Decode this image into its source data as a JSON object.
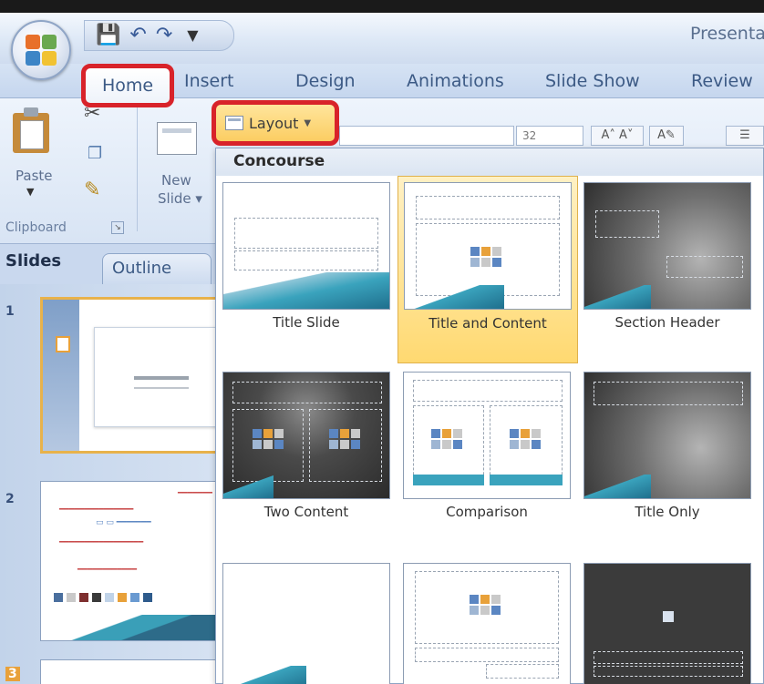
{
  "window": {
    "title": "Presenta"
  },
  "qat": {
    "save": "💾",
    "undo": "↶",
    "redo": "↷",
    "dropdown": "▼"
  },
  "tabs": {
    "home": "Home",
    "insert": "Insert",
    "design": "Design",
    "animations": "Animations",
    "slideshow": "Slide Show",
    "review": "Review"
  },
  "ribbon": {
    "paste": "Paste",
    "new_slide_1": "New",
    "new_slide_2": "Slide ▾",
    "clipboard_group": "Clipboard",
    "layout": "Layout",
    "font_size": "32"
  },
  "pane": {
    "slides_tab": "Slides",
    "outline_tab": "Outline",
    "slide_numbers": [
      "1",
      "2",
      "3"
    ]
  },
  "gallery": {
    "theme": "Concourse",
    "layouts": [
      {
        "label": "Title Slide",
        "selected": false
      },
      {
        "label": "Title and Content",
        "selected": true
      },
      {
        "label": "Section Header",
        "selected": false
      },
      {
        "label": "Two Content",
        "selected": false
      },
      {
        "label": "Comparison",
        "selected": false
      },
      {
        "label": "Title Only",
        "selected": false
      }
    ]
  },
  "colors": {
    "highlight_red": "#d8232a",
    "accent_teal": "#3aa3bd",
    "selected_gold": "#ffd971"
  }
}
